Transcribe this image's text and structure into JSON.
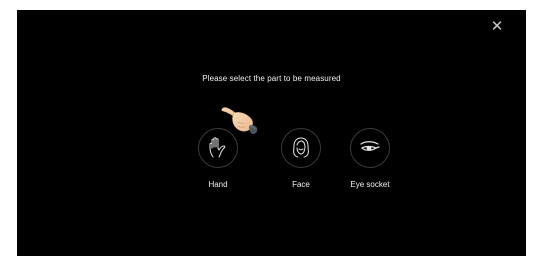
{
  "dialog": {
    "close_icon": "close-icon",
    "prompt": "Please select the part to be measured"
  },
  "options": [
    {
      "label": "Hand",
      "icon": "hand-icon"
    },
    {
      "label": "Face",
      "icon": "face-icon"
    },
    {
      "label": "Eye socket",
      "icon": "eye-socket-icon"
    }
  ],
  "hint": {
    "icon": "pointing-hand-icon"
  },
  "colors": {
    "background": "#000000",
    "text": "#f2f2f2",
    "ring_border": "#3a3a3a",
    "icon_stroke": "#e6e6e6"
  }
}
